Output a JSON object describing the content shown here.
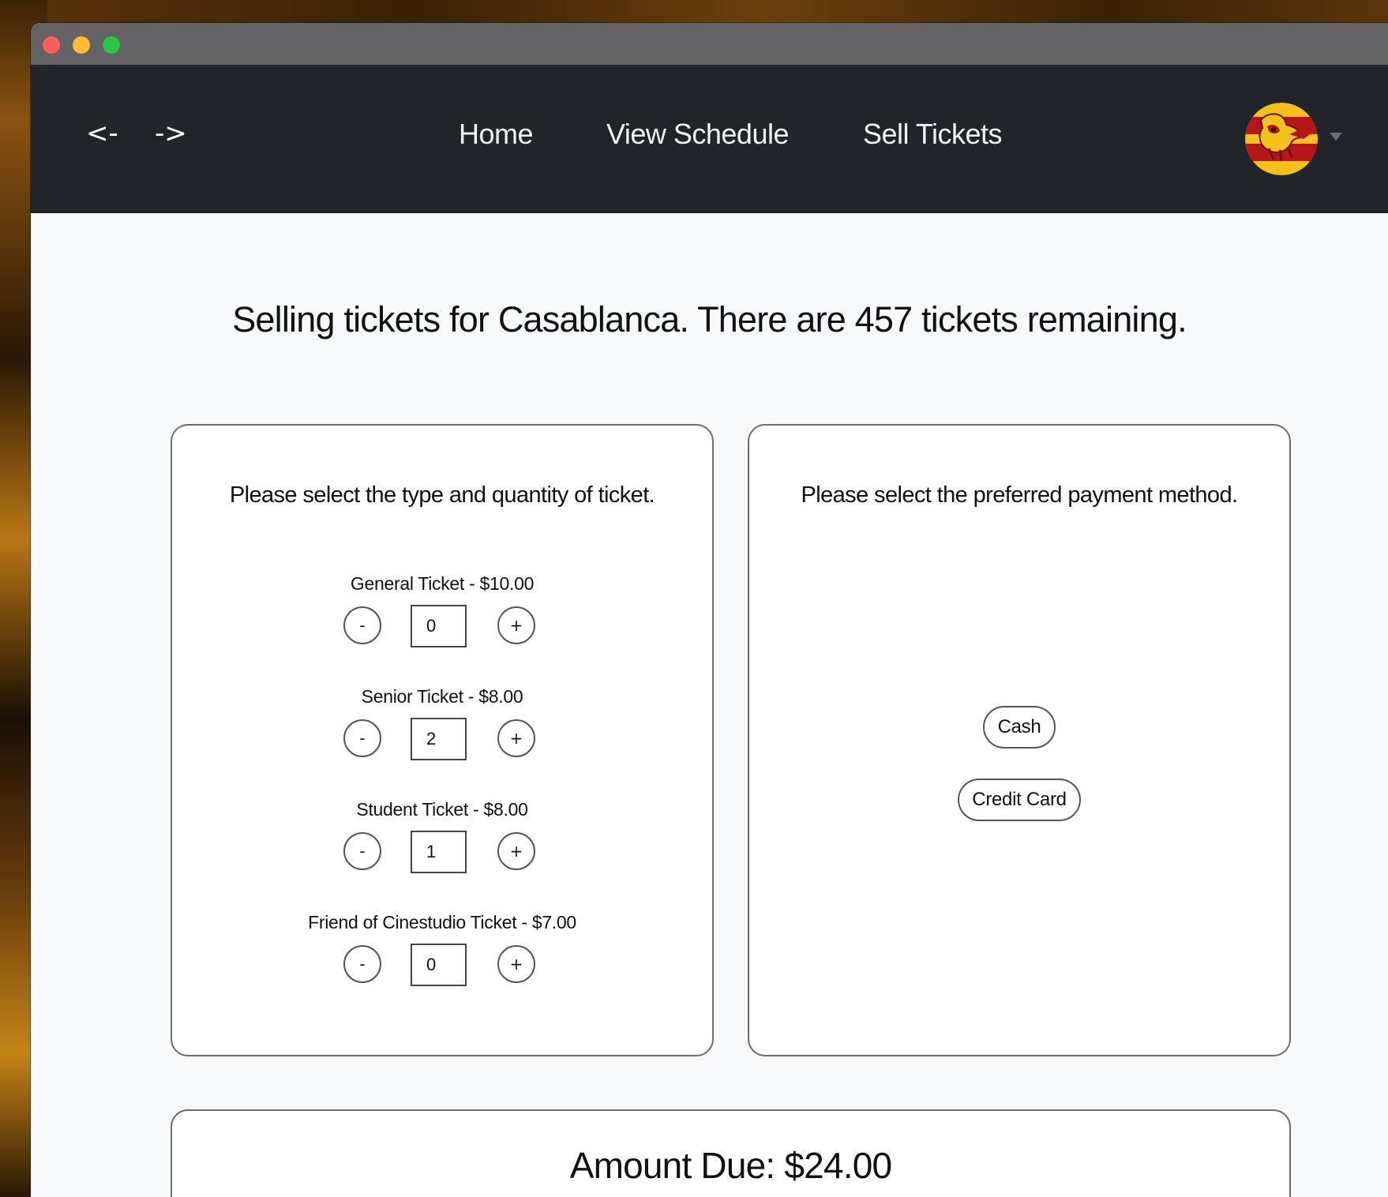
{
  "nav": {
    "back_label": "<-",
    "forward_label": "->",
    "links": [
      {
        "label": "Home"
      },
      {
        "label": "View Schedule"
      },
      {
        "label": "Sell Tickets"
      }
    ],
    "avatar_icon": "crest-avatar-icon"
  },
  "headline": "Selling tickets for Casablanca. There are 457 tickets remaining.",
  "tickets": {
    "title": "Please select the type and quantity of ticket.",
    "minus_label": "-",
    "plus_label": "+",
    "items": [
      {
        "label": "General Ticket - $10.00",
        "quantity": "0"
      },
      {
        "label": "Senior Ticket - $8.00",
        "quantity": "2"
      },
      {
        "label": "Student Ticket - $8.00",
        "quantity": "1"
      },
      {
        "label": "Friend of Cinestudio Ticket - $7.00",
        "quantity": "0"
      }
    ]
  },
  "payment": {
    "title": "Please select the preferred payment method.",
    "options": [
      {
        "label": "Cash"
      },
      {
        "label": "Credit Card"
      }
    ]
  },
  "amount_due": "Amount Due: $24.00",
  "colors": {
    "navbar": "#212429",
    "titlebar": "#636265",
    "page_bg": "#f7f8fa",
    "avatar_red": "#b5161c",
    "avatar_gold": "#f2c21b"
  }
}
